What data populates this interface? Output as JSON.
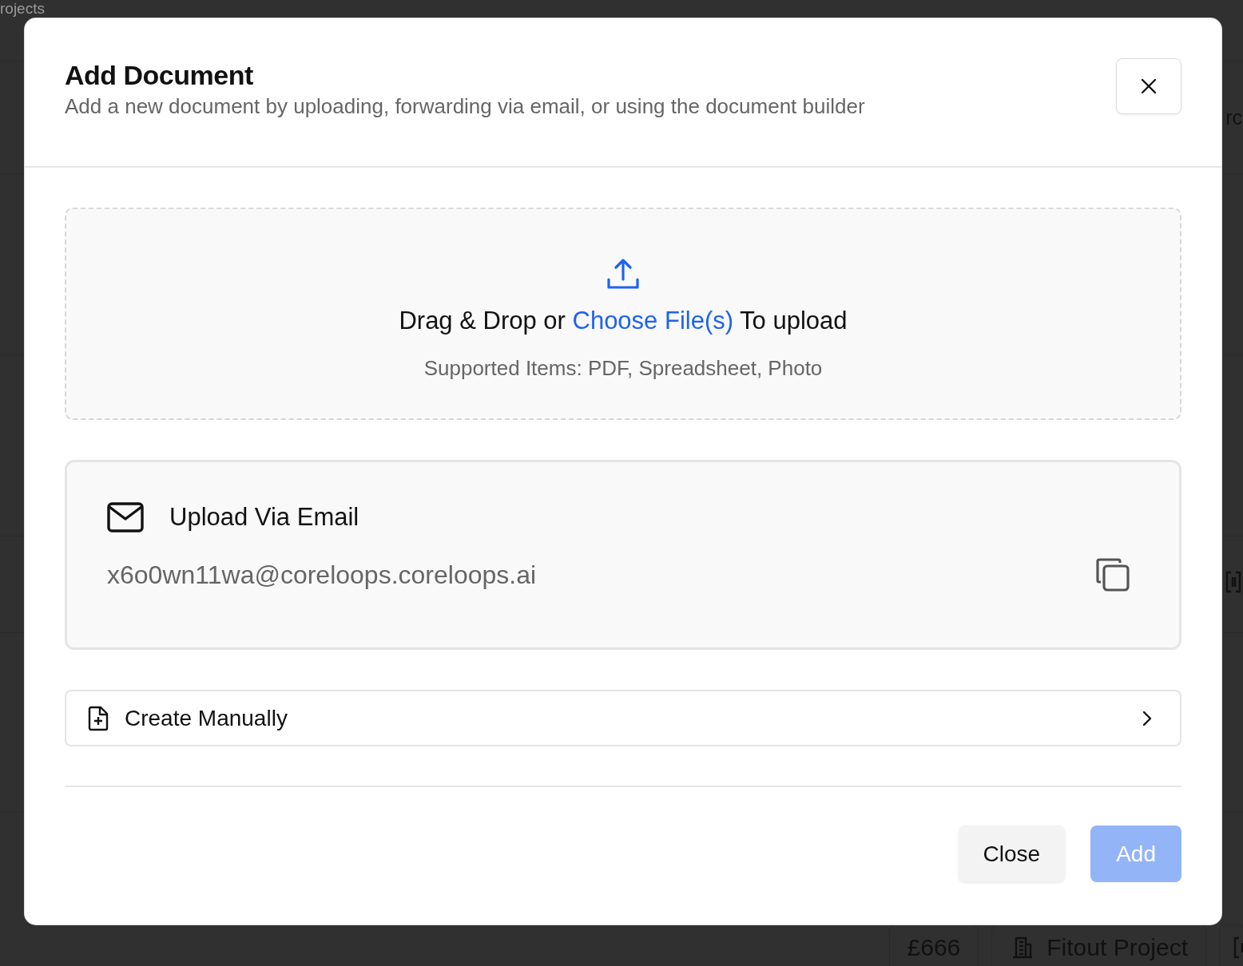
{
  "background": {
    "page_title": "rojects",
    "header_fragment": "rc",
    "row_cells": [
      {
        "kind": "amount",
        "text": "£666"
      },
      {
        "kind": "project",
        "text": "Fitout Project"
      }
    ]
  },
  "dialog": {
    "title": "Add Document",
    "subtitle": "Add a new document by uploading, forwarding via email, or using the document builder",
    "dropzone": {
      "text_before": "Drag & Drop or",
      "link": "Choose File(s)",
      "text_after": "To upload",
      "supported": "Supported Items: PDF, Spreadsheet, Photo"
    },
    "email": {
      "title": "Upload Via Email",
      "address": "x6o0wn11wa@coreloops.coreloops.ai"
    },
    "create_manually": {
      "label": "Create Manually"
    },
    "buttons": [
      {
        "label": "Close",
        "kind": "secondary",
        "disabled": false
      },
      {
        "label": "Add",
        "kind": "primary",
        "disabled": true
      }
    ]
  }
}
